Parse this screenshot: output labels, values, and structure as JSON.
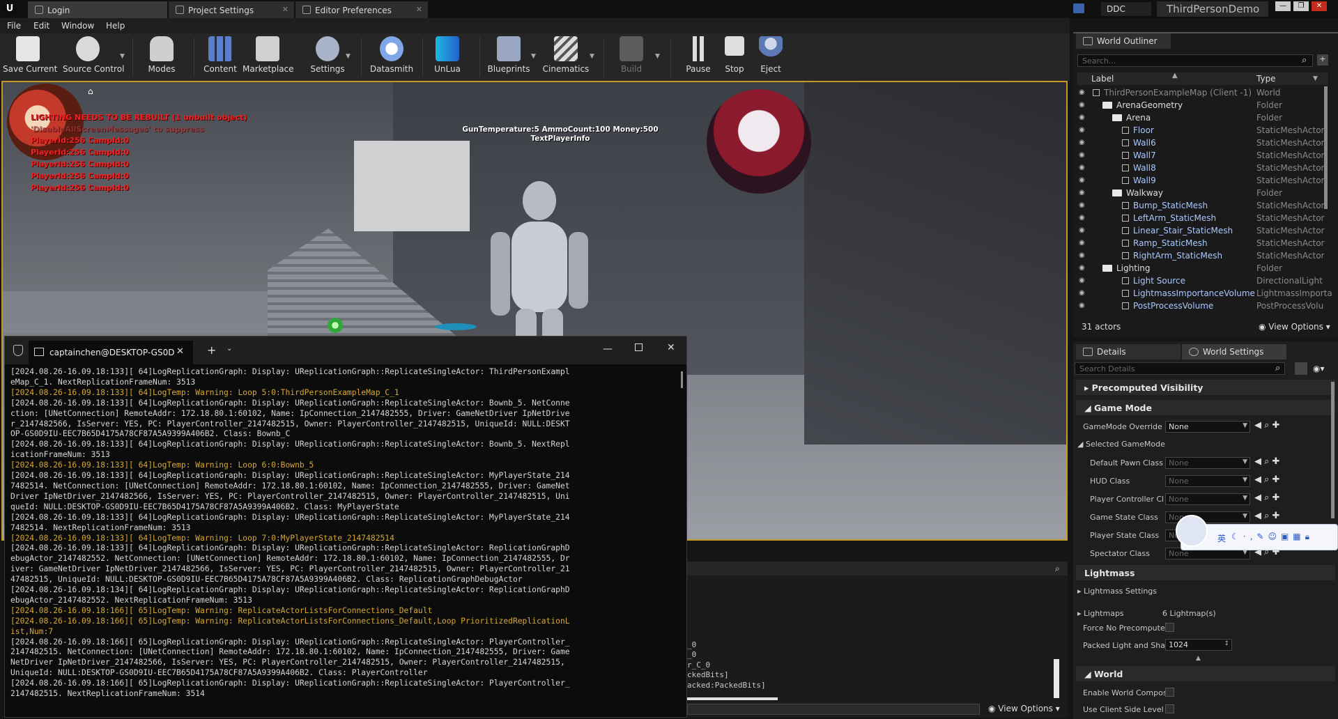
{
  "titlebar": {
    "tabs": [
      "Login",
      "Project Settings",
      "Editor Preferences"
    ],
    "ddc_label": "DDC",
    "project_name": "ThirdPersonDemo",
    "win_min": "—",
    "win_max": "❐",
    "win_close": "✕"
  },
  "menu": [
    "File",
    "Edit",
    "Window",
    "Help"
  ],
  "toolbar": [
    {
      "label": "Save Current",
      "icon": "save-icon"
    },
    {
      "label": "Source Control",
      "icon": "source-control-icon"
    },
    {
      "label": "Modes",
      "icon": "modes-icon"
    },
    {
      "label": "Content",
      "icon": "content-icon"
    },
    {
      "label": "Marketplace",
      "icon": "marketplace-icon"
    },
    {
      "label": "Settings",
      "icon": "settings-icon"
    },
    {
      "label": "Datasmith",
      "icon": "datasmith-icon"
    },
    {
      "label": "UnLua",
      "icon": "unlua-icon"
    },
    {
      "label": "Blueprints",
      "icon": "blueprints-icon"
    },
    {
      "label": "Cinematics",
      "icon": "cinematics-icon"
    },
    {
      "label": "Build",
      "icon": "build-icon"
    },
    {
      "label": "Pause",
      "icon": "pause-icon"
    },
    {
      "label": "Stop",
      "icon": "stop-icon"
    },
    {
      "label": "Eject",
      "icon": "eject-icon"
    }
  ],
  "viewport": {
    "lighting_warning": "LIGHTING NEEDS TO BE REBUILT (1 unbuilt object)",
    "disable_hint": "'DisableAllScreenMessages' to suppress",
    "player_lines": [
      "PlayerId:256 CampId:0",
      "PlayerId:256 CampId:0",
      "PlayerId:256 CampId:0",
      "PlayerId:256 CampId:0",
      "PlayerId:256 CampId:0"
    ],
    "hud_line1": "GunTemperature:5 AmmoCount:100 Money:500",
    "hud_line2": "TextPlayerInfo"
  },
  "terminal": {
    "tab_title": "captainchen@DESKTOP-GS0D",
    "lines": [
      {
        "t": "[2024.08.26-16.09.18:133][ 64]LogReplicationGraph: Display: UReplicationGraph::ReplicateSingleActor: ThirdPersonExampl",
        "w": false
      },
      {
        "t": "eMap_C_1. NextReplicationFrameNum: 3513",
        "w": false
      },
      {
        "t": "[2024.08.26-16.09.18:133][ 64]LogTemp: Warning: Loop 5:0:ThirdPersonExampleMap_C_1",
        "w": true
      },
      {
        "t": "[2024.08.26-16.09.18:133][ 64]LogReplicationGraph: Display: UReplicationGraph::ReplicateSingleActor: Bownb_5. NetConne",
        "w": false
      },
      {
        "t": "ction: [UNetConnection] RemoteAddr: 172.18.80.1:60102, Name: IpConnection_2147482555, Driver: GameNetDriver IpNetDrive",
        "w": false
      },
      {
        "t": "r_2147482566, IsServer: YES, PC: PlayerController_2147482515, Owner: PlayerController_2147482515, UniqueId: NULL:DESKT",
        "w": false
      },
      {
        "t": "OP-GS0D9IU-EEC7B65D4175A78CF87A5A9399A406B2. Class: Bownb_C",
        "w": false
      },
      {
        "t": "[2024.08.26-16.09.18:133][ 64]LogReplicationGraph: Display: UReplicationGraph::ReplicateSingleActor: Bownb_5. NextRepl",
        "w": false
      },
      {
        "t": "icationFrameNum: 3513",
        "w": false
      },
      {
        "t": "[2024.08.26-16.09.18:133][ 64]LogTemp: Warning: Loop 6:0:Bownb_5",
        "w": true
      },
      {
        "t": "[2024.08.26-16.09.18:133][ 64]LogReplicationGraph: Display: UReplicationGraph::ReplicateSingleActor: MyPlayerState_214",
        "w": false
      },
      {
        "t": "7482514. NetConnection: [UNetConnection] RemoteAddr: 172.18.80.1:60102, Name: IpConnection_2147482555, Driver: GameNet",
        "w": false
      },
      {
        "t": "Driver IpNetDriver_2147482566, IsServer: YES, PC: PlayerController_2147482515, Owner: PlayerController_2147482515, Uni",
        "w": false
      },
      {
        "t": "queId: NULL:DESKTOP-GS0D9IU-EEC7B65D4175A78CF87A5A9399A406B2. Class: MyPlayerState",
        "w": false
      },
      {
        "t": "[2024.08.26-16.09.18:133][ 64]LogReplicationGraph: Display: UReplicationGraph::ReplicateSingleActor: MyPlayerState_214",
        "w": false
      },
      {
        "t": "7482514. NextReplicationFrameNum: 3513",
        "w": false
      },
      {
        "t": "[2024.08.26-16.09.18:133][ 64]LogTemp: Warning: Loop 7:0:MyPlayerState_2147482514",
        "w": true
      },
      {
        "t": "[2024.08.26-16.09.18:133][ 64]LogReplicationGraph: Display: UReplicationGraph::ReplicateSingleActor: ReplicationGraphD",
        "w": false
      },
      {
        "t": "ebugActor_2147482552. NetConnection: [UNetConnection] RemoteAddr: 172.18.80.1:60102, Name: IpConnection_2147482555, Dr",
        "w": false
      },
      {
        "t": "iver: GameNetDriver IpNetDriver_2147482566, IsServer: YES, PC: PlayerController_2147482515, Owner: PlayerController_21",
        "w": false
      },
      {
        "t": "47482515, UniqueId: NULL:DESKTOP-GS0D9IU-EEC7B65D4175A78CF87A5A9399A406B2. Class: ReplicationGraphDebugActor",
        "w": false
      },
      {
        "t": "[2024.08.26-16.09.18:134][ 64]LogReplicationGraph: Display: UReplicationGraph::ReplicateSingleActor: ReplicationGraphD",
        "w": false
      },
      {
        "t": "ebugActor_2147482552. NextReplicationFrameNum: 3513",
        "w": false
      },
      {
        "t": "[2024.08.26-16.09.18:166][ 65]LogTemp: Warning: ReplicateActorListsForConnections_Default",
        "w": true
      },
      {
        "t": "[2024.08.26-16.09.18:166][ 65]LogTemp: Warning: ReplicateActorListsForConnections_Default,Loop PrioritizedReplicationL",
        "w": true
      },
      {
        "t": "ist,Num:7",
        "w": true
      },
      {
        "t": "[2024.08.26-16.09.18:166][ 65]LogReplicationGraph: Display: UReplicationGraph::ReplicateSingleActor: PlayerController_",
        "w": false
      },
      {
        "t": "2147482515. NetConnection: [UNetConnection] RemoteAddr: 172.18.80.1:60102, Name: IpConnection_2147482555, Driver: Game",
        "w": false
      },
      {
        "t": "NetDriver IpNetDriver_2147482566, IsServer: YES, PC: PlayerController_2147482515, Owner: PlayerController_2147482515,",
        "w": false
      },
      {
        "t": "UniqueId: NULL:DESKTOP-GS0D9IU-EEC7B65D4175A78CF87A5A9399A406B2. Class: PlayerController",
        "w": false
      },
      {
        "t": "[2024.08.26-16.09.18:166][ 65]LogReplicationGraph: Display: UReplicationGraph::ReplicateSingleActor: PlayerController_",
        "w": false
      },
      {
        "t": "2147482515. NextReplicationFrameNum: 3514",
        "w": false
      }
    ]
  },
  "output_log": {
    "lines": [
      "_0",
      "_0",
      "r_C_0",
      "ckedBits]",
      "acked:PackedBits]"
    ],
    "view_options": "View Options"
  },
  "outliner": {
    "tab": "World Outliner",
    "search_placeholder": "Search...",
    "col_label": "Label",
    "col_type": "Type",
    "rows": [
      {
        "name": "ThirdPersonExampleMap (Client -1)",
        "type": "World",
        "kind": "world"
      },
      {
        "name": "ArenaGeometry",
        "type": "Folder",
        "kind": "folder"
      },
      {
        "name": "Arena",
        "type": "Folder",
        "kind": "folder"
      },
      {
        "name": "Floor",
        "type": "StaticMeshActor",
        "kind": "mesh"
      },
      {
        "name": "Wall6",
        "type": "StaticMeshActor",
        "kind": "mesh"
      },
      {
        "name": "Wall7",
        "type": "StaticMeshActor",
        "kind": "mesh"
      },
      {
        "name": "Wall8",
        "type": "StaticMeshActor",
        "kind": "mesh"
      },
      {
        "name": "Wall9",
        "type": "StaticMeshActor",
        "kind": "mesh"
      },
      {
        "name": "Walkway",
        "type": "Folder",
        "kind": "folder"
      },
      {
        "name": "Bump_StaticMesh",
        "type": "StaticMeshActor",
        "kind": "mesh"
      },
      {
        "name": "LeftArm_StaticMesh",
        "type": "StaticMeshActor",
        "kind": "mesh"
      },
      {
        "name": "Linear_Stair_StaticMesh",
        "type": "StaticMeshActor",
        "kind": "mesh"
      },
      {
        "name": "Ramp_StaticMesh",
        "type": "StaticMeshActor",
        "kind": "mesh"
      },
      {
        "name": "RightArm_StaticMesh",
        "type": "StaticMeshActor",
        "kind": "mesh"
      },
      {
        "name": "Lighting",
        "type": "Folder",
        "kind": "folder"
      },
      {
        "name": "Light Source",
        "type": "DirectionalLight",
        "kind": "mesh"
      },
      {
        "name": "LightmassImportanceVolume",
        "type": "LightmassImporta",
        "kind": "mesh"
      },
      {
        "name": "PostProcessVolume",
        "type": "PostProcessVolu",
        "kind": "mesh"
      }
    ],
    "actor_count": "31 actors",
    "view_options": "View Options"
  },
  "details": {
    "tab_details": "Details",
    "tab_world_settings": "World Settings",
    "search_placeholder": "Search Details",
    "sections": {
      "precomputed_visibility": "Precomputed Visibility",
      "game_mode": "Game Mode",
      "lightmass": "Lightmass",
      "world": "World"
    },
    "gamemode_override": {
      "label": "GameMode Override",
      "value": "None"
    },
    "selected_gamemode": "Selected GameMode",
    "class_rows": [
      {
        "label": "Default Pawn Class",
        "value": "None"
      },
      {
        "label": "HUD Class",
        "value": "None"
      },
      {
        "label": "Player Controller Cl",
        "value": "None"
      },
      {
        "label": "Game State Class",
        "value": "None"
      },
      {
        "label": "Player State Class",
        "value": "Non"
      },
      {
        "label": "Spectator Class",
        "value": "None"
      }
    ],
    "lightmass_settings": "Lightmass Settings",
    "lightmaps_label": "Lightmaps",
    "lightmaps_value": "6 Lightmap(s)",
    "force_no_precompute": "Force No Precompute",
    "packed_light_label": "Packed Light and Shac",
    "packed_light_value": "1024",
    "enable_world_compo": "Enable World Composi",
    "use_client_side": "Use Client Side Level :"
  },
  "ime": {
    "lang": "英"
  }
}
